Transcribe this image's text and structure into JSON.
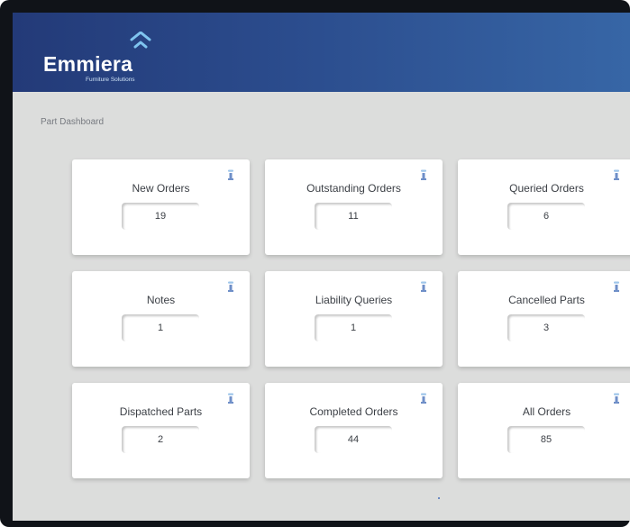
{
  "brand": {
    "name": "Emmiera",
    "tagline": "Furniture Solutions"
  },
  "breadcrumb": "Part Dashboard",
  "colors": {
    "header_start": "#233a78",
    "header_end": "#3766a6",
    "background": "#dcdddc",
    "tile": "#ffffff",
    "text": "#3b3f45",
    "info_icon": "#6f8fc8"
  },
  "tiles": [
    {
      "label": "New Orders",
      "value": "19",
      "icon": "info-icon"
    },
    {
      "label": "Outstanding Orders",
      "value": "11",
      "icon": "info-icon"
    },
    {
      "label": "Queried Orders",
      "value": "6",
      "icon": "info-icon"
    },
    {
      "label": "Notes",
      "value": "1",
      "icon": "info-icon"
    },
    {
      "label": "Liability Queries",
      "value": "1",
      "icon": "info-icon"
    },
    {
      "label": "Cancelled Parts",
      "value": "3",
      "icon": "info-icon"
    },
    {
      "label": "Dispatched Parts",
      "value": "2",
      "icon": "info-icon"
    },
    {
      "label": "Completed Orders",
      "value": "44",
      "icon": "info-icon"
    },
    {
      "label": "All Orders",
      "value": "85",
      "icon": "info-icon"
    }
  ]
}
